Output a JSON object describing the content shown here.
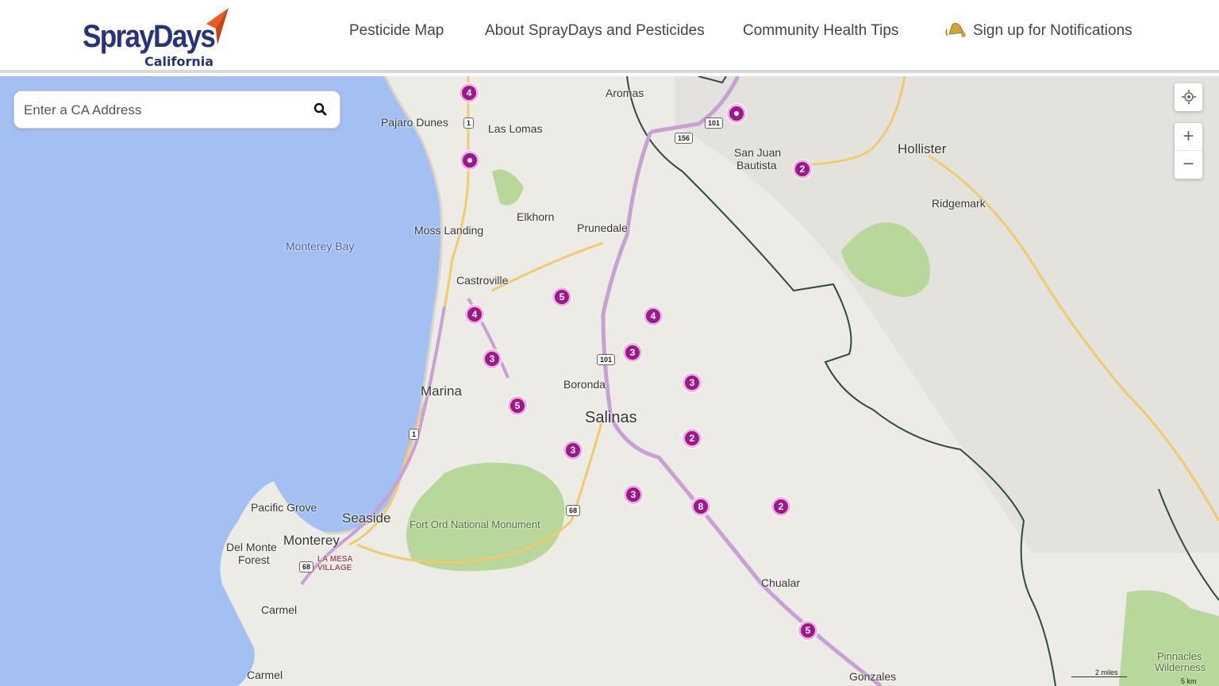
{
  "header": {
    "logo": {
      "word": "SprayDays",
      "sub": "California"
    },
    "nav": [
      {
        "label": "Pesticide Map"
      },
      {
        "label": "About SprayDays and Pesticides"
      },
      {
        "label": "Community Health Tips"
      },
      {
        "label": "Sign up for Notifications",
        "icon": "bell-icon"
      }
    ]
  },
  "search": {
    "placeholder": "Enter a CA Address",
    "value": "",
    "icon": "search-icon"
  },
  "controls": {
    "locate_icon": "crosshair-icon",
    "zoom_in": "+",
    "zoom_out": "−"
  },
  "places": {
    "aromas": "Aromas",
    "pajaro_dunes": "Pajaro Dunes",
    "las_lomas": "Las Lomas",
    "san_juan": "San Juan",
    "bautista": "Bautista",
    "hollister": "Hollister",
    "ridgemark": "Ridgemark",
    "elkhorn": "Elkhorn",
    "moss_landing": "Moss Landing",
    "prunedale": "Prunedale",
    "monterey_bay": "Monterey Bay",
    "castroville": "Castroville",
    "marina": "Marina",
    "boronda": "Boronda",
    "salinas": "Salinas",
    "pacific_grove": "Pacific Grove",
    "seaside": "Seaside",
    "fort_ord": "Fort Ord National Monument",
    "monterey": "Monterey",
    "del_monte": "Del Monte",
    "forest": "Forest",
    "la_mesa": "LA MESA",
    "village": "VILLAGE",
    "carmel": "Carmel",
    "carmel2": "Carmel",
    "chualar": "Chualar",
    "gonzales": "Gonzales",
    "pinnacles": "Pinnacles",
    "wilderness": "Wilderness"
  },
  "shields": [
    "1",
    "101",
    "156",
    "101",
    "1",
    "68",
    "68"
  ],
  "markers": [
    "4",
    "",
    "",
    "2",
    "5",
    "4",
    "4",
    "3",
    "3",
    "3",
    "5",
    "2",
    "3",
    "3",
    "8",
    "2",
    "5"
  ],
  "scale": {
    "miles": "2 miles",
    "km": "5 km"
  },
  "colors": {
    "marker": "#a0178c",
    "water": "#a4c0f3",
    "land": "#ecebe6",
    "park": "#b8d79a",
    "brand": "#26347a",
    "accent": "#f05a22"
  }
}
